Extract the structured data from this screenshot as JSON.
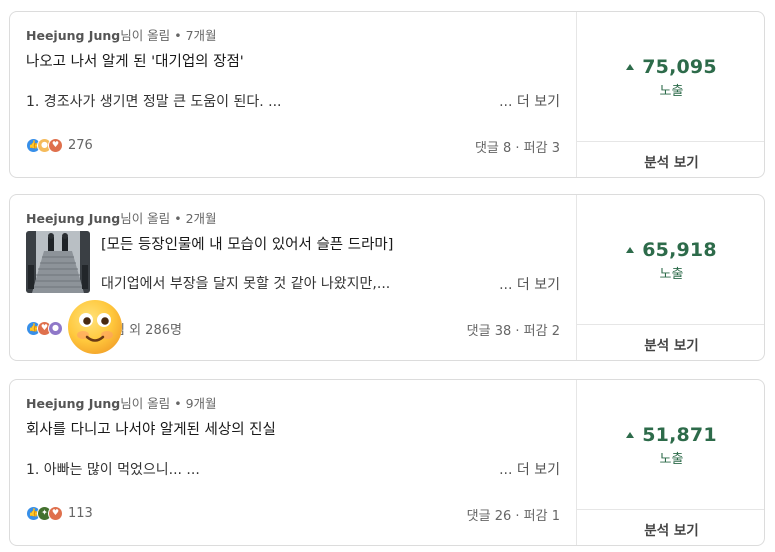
{
  "posts": [
    {
      "author": "Heejung Jung",
      "posted_suffix": "님이 올림",
      "time_ago": "7개월",
      "title": "나오고 나서 알게 된 '대기업의 장점'",
      "excerpt": "1. 경조사가 생기면 정말 큰 도움이 된다. ...",
      "see_more": "... 더 보기",
      "reaction_icons": [
        "like-icon",
        "insight-icon",
        "love-icon"
      ],
      "reaction_count": "276",
      "stats": "댓글 8 · 퍼감 3",
      "impressions_value": "75,095",
      "impressions_label": "노출",
      "analytics_button": "분석 보기"
    },
    {
      "author": "Heejung Jung",
      "posted_suffix": "님이 올림",
      "time_ago": "2개월",
      "title": "[모든 등장인물에 내 모습이 있어서 슬픈 드라마]",
      "excerpt": "대기업에서 부장을 달지 못할 것 같아 나왔지만,...",
      "see_more": "... 더 보기",
      "has_thumbnail": true,
      "reaction_icons": [
        "like-icon",
        "love-icon",
        "support-icon"
      ],
      "reaction_count": "님 외 286명",
      "stats": "댓글 38 · 퍼감 2",
      "impressions_value": "65,918",
      "impressions_label": "노출",
      "analytics_button": "분석 보기"
    },
    {
      "author": "Heejung Jung",
      "posted_suffix": "님이 올림",
      "time_ago": "9개월",
      "title": "회사를 다니고 나서야 알게된 세상의 진실",
      "excerpt": "1. 아빠는 많이 먹었으니... ...",
      "see_more": "... 더 보기",
      "reaction_icons": [
        "like-icon",
        "celebrate-icon",
        "love-icon"
      ],
      "reaction_count": "113",
      "stats": "댓글 26 · 퍼감 1",
      "impressions_value": "51,871",
      "impressions_label": "노출",
      "analytics_button": "분석 보기"
    }
  ],
  "colors": {
    "impressions": "#2d6b4a",
    "like": "#378fe9",
    "love": "#df704d",
    "insight": "#f5bb5c",
    "celebrate": "#44712e",
    "support": "#8f78c8"
  }
}
